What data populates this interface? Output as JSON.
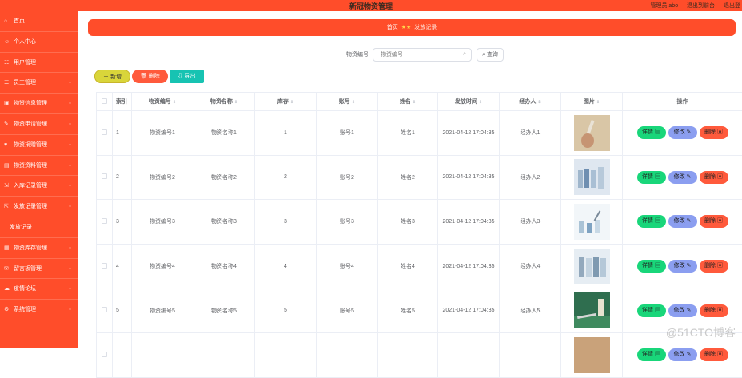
{
  "topbar": {
    "title": "新冠物资管理",
    "admin": "管理员 abo",
    "exit_front": "退出到前台",
    "logout": "退出登"
  },
  "sidebar": {
    "items": [
      {
        "label": "首页",
        "icon": "home-icon"
      },
      {
        "label": "个人中心",
        "icon": "user-icon"
      },
      {
        "label": "用户管理",
        "icon": "users-icon"
      },
      {
        "label": "员工管理",
        "icon": "staff-icon",
        "arrow": true
      },
      {
        "label": "物资信息管理",
        "icon": "box-icon",
        "arrow": true
      },
      {
        "label": "物资申请管理",
        "icon": "apply-icon",
        "arrow": true
      },
      {
        "label": "物资捐赠管理",
        "icon": "donate-icon",
        "arrow": true
      },
      {
        "label": "物资资料管理",
        "icon": "folder-icon",
        "arrow": true
      },
      {
        "label": "入库记录管理",
        "icon": "inbox-icon",
        "arrow": true
      },
      {
        "label": "发放记录管理",
        "icon": "outbox-icon",
        "arrow": true
      },
      {
        "label": "发放记录",
        "icon": "",
        "sub": true
      },
      {
        "label": "物资库存管理",
        "icon": "stock-icon",
        "arrow": true
      },
      {
        "label": "留言板管理",
        "icon": "message-icon",
        "arrow": true
      },
      {
        "label": "疫情论坛",
        "icon": "forum-icon",
        "arrow": true
      },
      {
        "label": "系统管理",
        "icon": "settings-icon",
        "arrow": true
      }
    ]
  },
  "breadcrumb": {
    "home": "首页",
    "current": "发放记录"
  },
  "search": {
    "label": "物资编号",
    "placeholder": "物资编号",
    "button": "查询"
  },
  "actions": {
    "add": "新增",
    "delete": "删除",
    "export": "导出"
  },
  "table": {
    "columns": [
      "索引",
      "物资编号",
      "物资名称",
      "库存",
      "账号",
      "姓名",
      "发放时间",
      "经办人",
      "图片",
      "操作"
    ],
    "rows": [
      {
        "index": "1",
        "code": "物资编号1",
        "name": "物资名称1",
        "stock": "1",
        "account": "账号1",
        "person": "姓名1",
        "time": "2021-04-12 17:04:35",
        "handler": "经办人1"
      },
      {
        "index": "2",
        "code": "物资编号2",
        "name": "物资名称2",
        "stock": "2",
        "account": "账号2",
        "person": "姓名2",
        "time": "2021-04-12 17:04:35",
        "handler": "经办人2"
      },
      {
        "index": "3",
        "code": "物资编号3",
        "name": "物资名称3",
        "stock": "3",
        "account": "账号3",
        "person": "姓名3",
        "time": "2021-04-12 17:04:35",
        "handler": "经办人3"
      },
      {
        "index": "4",
        "code": "物资编号4",
        "name": "物资名称4",
        "stock": "4",
        "account": "账号4",
        "person": "姓名4",
        "time": "2021-04-12 17:04:35",
        "handler": "经办人4"
      },
      {
        "index": "5",
        "code": "物资编号5",
        "name": "物资名称5",
        "stock": "5",
        "account": "账号5",
        "person": "姓名5",
        "time": "2021-04-12 17:04:35",
        "handler": "经办人5"
      },
      {
        "index": "",
        "code": "",
        "name": "",
        "stock": "",
        "account": "",
        "person": "",
        "time": "",
        "handler": ""
      }
    ],
    "op_detail": "详情",
    "op_edit": "修改",
    "op_delete": "删除"
  },
  "watermark": "@51CTO博客",
  "colors": {
    "primary": "#ff4d2a",
    "detail": "#19d67a",
    "edit": "#8b9ef0",
    "delete": "#ff5a3c",
    "add": "#d9d53a",
    "export": "#17c3b2"
  }
}
